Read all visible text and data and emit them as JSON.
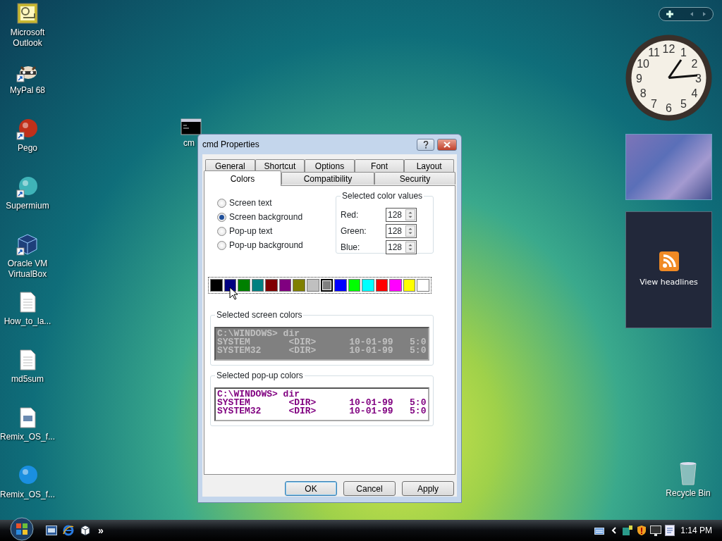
{
  "desktop_icons": [
    {
      "label": "Microsoft Outlook",
      "kind": "mail",
      "shortcut": false
    },
    {
      "label": "MyPal 68",
      "kind": "raccoon",
      "shortcut": true
    },
    {
      "label": "Pego",
      "kind": "ball",
      "shortcut": true,
      "color": "#c0301a"
    },
    {
      "label": "Supermium",
      "kind": "ball",
      "shortcut": true,
      "color": "#3fb3b8"
    },
    {
      "label": "Oracle VM VirtualBox",
      "kind": "cube",
      "shortcut": true
    },
    {
      "label": "How_to_la...",
      "kind": "document",
      "shortcut": false
    },
    {
      "label": "md5sum",
      "kind": "document",
      "shortcut": false
    },
    {
      "label": "Remix_OS_f...",
      "kind": "image-doc",
      "shortcut": false
    },
    {
      "label": "Remix_OS_f...",
      "kind": "ball",
      "shortcut": false,
      "color": "#1a8fe0"
    }
  ],
  "hidden_icon": {
    "label": "cm"
  },
  "recycle_bin": {
    "label": "Recycle Bin"
  },
  "clock": {
    "numerals": [
      "12",
      "11",
      "1",
      "10",
      "2",
      "9",
      "3",
      "8",
      "4",
      "7",
      "5",
      "6"
    ]
  },
  "feed_gadget": {
    "text": "View headlines"
  },
  "dialog": {
    "title": "cmd Properties",
    "tab_rows": [
      [
        {
          "label": "General",
          "selected": false
        },
        {
          "label": "Shortcut",
          "selected": false
        },
        {
          "label": "Options",
          "selected": false
        },
        {
          "label": "Font",
          "selected": false
        },
        {
          "label": "Layout",
          "selected": false
        }
      ],
      [
        {
          "label": "Colors",
          "selected": true
        },
        {
          "label": "Compatibility",
          "selected": false
        },
        {
          "label": "Security",
          "selected": false
        }
      ]
    ],
    "targets": [
      {
        "label": "Screen text",
        "selected": false
      },
      {
        "label": "Screen background",
        "selected": true
      },
      {
        "label": "Pop-up text",
        "selected": false
      },
      {
        "label": "Pop-up background",
        "selected": false
      }
    ],
    "color_values": {
      "title": "Selected color values",
      "fields": [
        {
          "label": "Red:",
          "value": "128"
        },
        {
          "label": "Green:",
          "value": "128"
        },
        {
          "label": "Blue:",
          "value": "128"
        }
      ]
    },
    "palette": [
      {
        "color": "#000000",
        "selected": false
      },
      {
        "color": "#000080",
        "selected": false
      },
      {
        "color": "#008000",
        "selected": false
      },
      {
        "color": "#008080",
        "selected": false
      },
      {
        "color": "#800000",
        "selected": false
      },
      {
        "color": "#800080",
        "selected": false
      },
      {
        "color": "#808000",
        "selected": false
      },
      {
        "color": "#c0c0c0",
        "selected": false
      },
      {
        "color": "#808080",
        "selected": true
      },
      {
        "color": "#0000ff",
        "selected": false
      },
      {
        "color": "#00ff00",
        "selected": false
      },
      {
        "color": "#00ffff",
        "selected": false
      },
      {
        "color": "#ff0000",
        "selected": false
      },
      {
        "color": "#ff00ff",
        "selected": false
      },
      {
        "color": "#ffff00",
        "selected": false
      },
      {
        "color": "#ffffff",
        "selected": false
      }
    ],
    "previews": [
      {
        "title": "Selected screen colors",
        "kind": "screen",
        "lines": [
          "C:\\WINDOWS> dir",
          "SYSTEM       <DIR>      10-01-99   5:0",
          "SYSTEM32     <DIR>      10-01-99   5:0"
        ]
      },
      {
        "title": "Selected pop-up colors",
        "kind": "popup",
        "lines": [
          "C:\\WINDOWS> dir",
          "SYSTEM       <DIR>      10-01-99   5:0",
          "SYSTEM32     <DIR>      10-01-99   5:0"
        ]
      }
    ],
    "buttons": [
      {
        "label": "OK",
        "default": true
      },
      {
        "label": "Cancel",
        "default": false
      },
      {
        "label": "Apply",
        "default": false
      }
    ]
  },
  "taskbar": {
    "chevron": "»",
    "time": "1:14 PM"
  }
}
